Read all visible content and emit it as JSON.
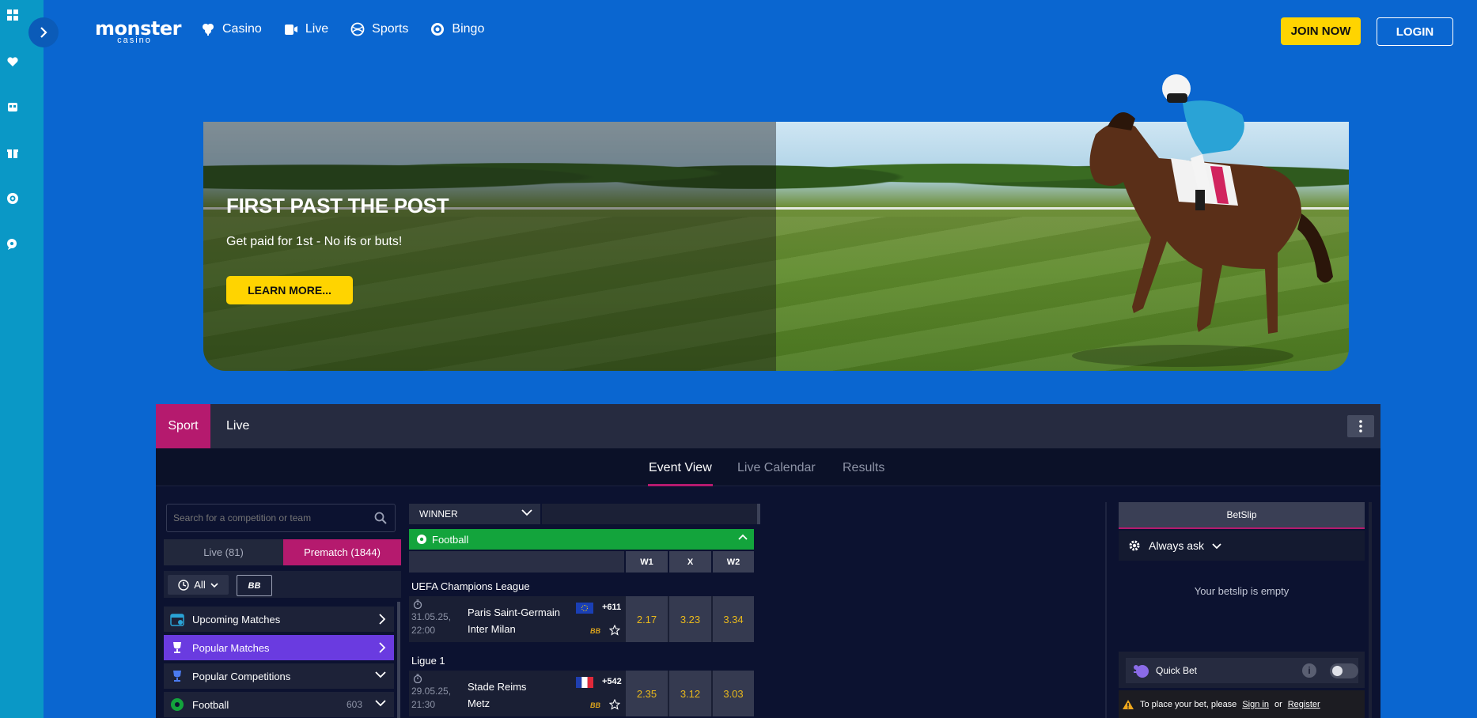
{
  "nav": {
    "logo_line1": "monster",
    "logo_line2": "casino",
    "items": [
      {
        "label": "Casino",
        "icon": "casino-icon"
      },
      {
        "label": "Live",
        "icon": "live-icon"
      },
      {
        "label": "Sports",
        "icon": "sports-icon"
      },
      {
        "label": "Bingo",
        "icon": "bingo-icon"
      }
    ],
    "join_label": "JOIN NOW",
    "login_label": "LOGIN"
  },
  "rail": {
    "icons": [
      "grid-icon",
      "heart-icon",
      "cards-icon",
      "gift-icon",
      "target-icon",
      "chat-icon"
    ],
    "toggle_icon": "chevron-right-icon"
  },
  "banner": {
    "title": "FIRST PAST THE POST",
    "subtitle": "Get paid for 1st - No ifs or buts!",
    "button_label": "LEARN MORE..."
  },
  "sportsbook": {
    "tabs": {
      "sport": "Sport",
      "live": "Live"
    },
    "view_tabs": [
      "Event View",
      "Live Calendar",
      "Results"
    ],
    "search_placeholder": "Search for a competition or team",
    "mode_live": "Live (81)",
    "mode_prematch": "Prematch (1844)",
    "filter_all": "All",
    "filter_bb": "BB",
    "menu": [
      {
        "label": "Upcoming Matches",
        "icon": "calendar-icon"
      },
      {
        "label": "Popular Matches",
        "icon": "trophy-icon"
      },
      {
        "label": "Popular Competitions",
        "icon": "cup-icon"
      },
      {
        "label": "Football",
        "icon": "football-icon",
        "count": "603"
      }
    ],
    "market_label": "WINNER",
    "sport_label": "Football",
    "columns": [
      "W1",
      "X",
      "W2"
    ],
    "leagues": [
      {
        "name": "UEFA Champions League",
        "event": {
          "date": "31.05.25,",
          "time": "22:00",
          "home": "Paris Saint-Germain",
          "away": "Inter Milan",
          "more": "+611",
          "bb": "BB",
          "odds": [
            "2.17",
            "3.23",
            "3.34"
          ]
        }
      },
      {
        "name": "Ligue 1",
        "event": {
          "date": "29.05.25,",
          "time": "21:30",
          "home": "Stade Reims",
          "away": "Metz",
          "more": "+542",
          "bb": "BB",
          "odds": [
            "2.35",
            "3.12",
            "3.03"
          ]
        }
      }
    ]
  },
  "betslip": {
    "title": "BetSlip",
    "mode": "Always ask",
    "empty_text": "Your betslip is empty",
    "quick_bet": "Quick Bet",
    "info_glyph": "i",
    "warn_text": "To place your bet, please",
    "sign_in": "Sign in",
    "or": "or",
    "register": "Register"
  },
  "colors": {
    "page_bg": "#0a66d0",
    "rail_bg": "#0a98c6",
    "accent_yellow": "#ffd400",
    "accent_pink": "#b51a6e",
    "accent_purple": "#6a3be0",
    "football_green": "#13a43c",
    "odds_text": "#e9b91c"
  }
}
